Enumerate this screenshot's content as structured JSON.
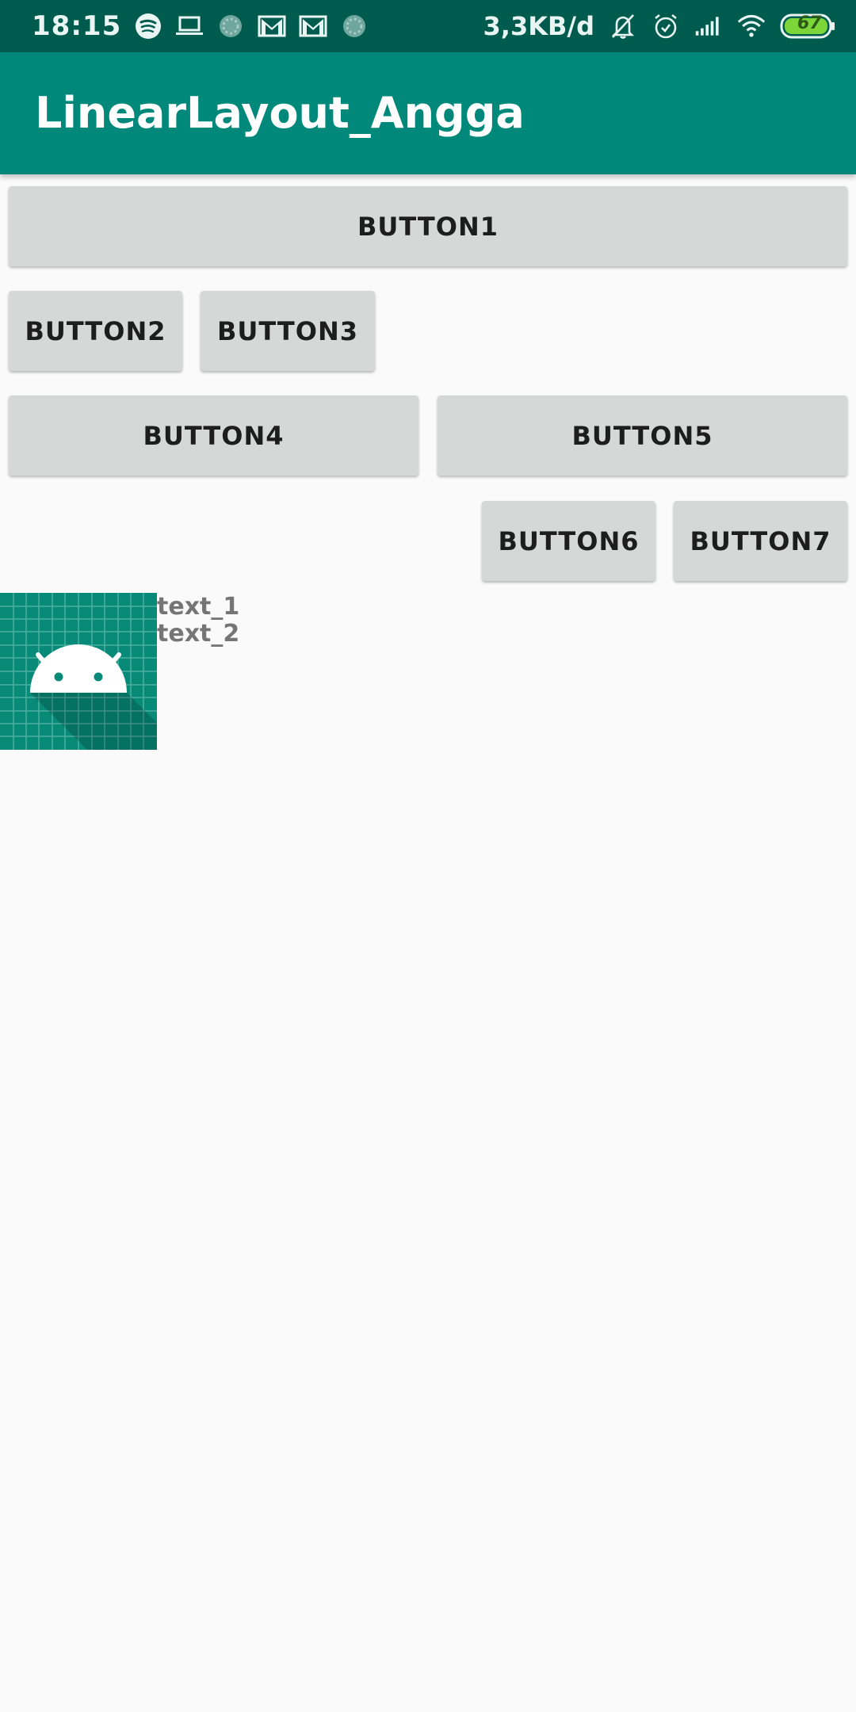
{
  "status_bar": {
    "time": "18:15",
    "net_speed": "3,3KB/d",
    "battery_level": "67",
    "icons": [
      "spotify-icon",
      "laptop-icon",
      "loading-icon",
      "gmail-icon",
      "gmail-icon",
      "loading-icon",
      "mute-icon",
      "alarm-icon",
      "signal-icon",
      "wifi-icon",
      "battery-icon"
    ]
  },
  "app_bar": {
    "title": "LinearLayout_Angga"
  },
  "buttons": {
    "b1": "Button1",
    "b2": "Button2",
    "b3": "Button3",
    "b4": "Button4",
    "b5": "Button5",
    "b6": "Button6",
    "b7": "Button7"
  },
  "content": {
    "image_icon": "android-launcher-icon",
    "text_1": "text_1",
    "text_2": "text_2"
  },
  "colors": {
    "status_bar": "#005b4f",
    "app_bar": "#00897b",
    "button_bg": "#d6d7d7",
    "battery_fill": "#7cd63a"
  }
}
